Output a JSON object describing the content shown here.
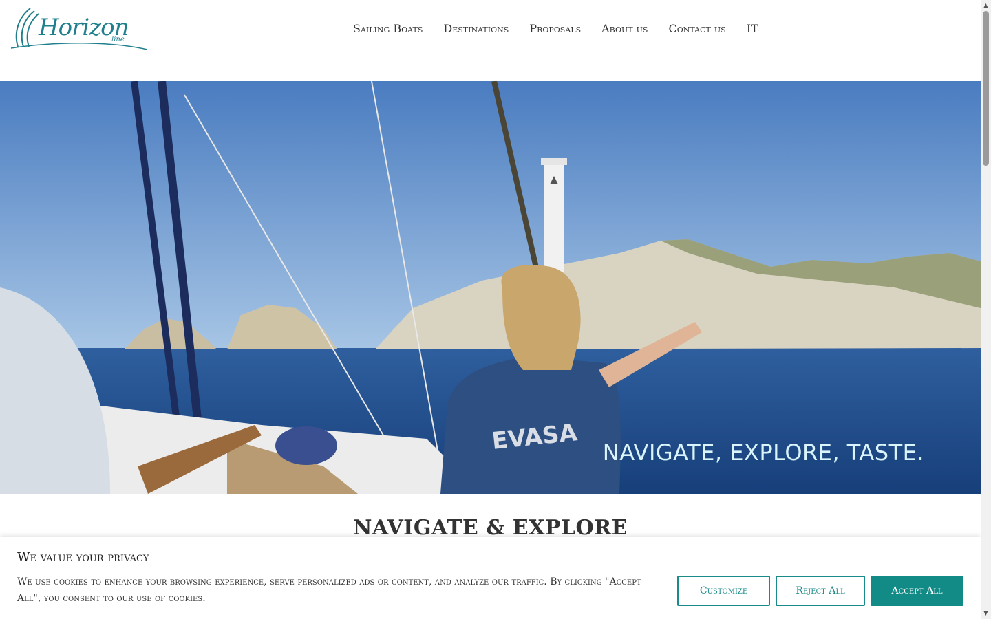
{
  "logo": {
    "text": "Horizon",
    "subtext": "line"
  },
  "nav": {
    "items": [
      {
        "label": "Sailing Boats"
      },
      {
        "label": "Destinations"
      },
      {
        "label": "Proposals"
      },
      {
        "label": "About us"
      },
      {
        "label": "Contact us"
      },
      {
        "label": "IT"
      }
    ]
  },
  "hero": {
    "caption": "NAVIGATE, EXPLORE, TASTE.",
    "shirt_text": "EVASA"
  },
  "section": {
    "title": "NAVIGATE & EXPLORE"
  },
  "cookie": {
    "title": "We value your privacy",
    "text": "We use cookies to enhance your browsing experience, serve personalized ads or content, and analyze our traffic. By clicking \"Accept All\", you consent to our use of cookies.",
    "customize_label": "Customize",
    "reject_label": "Reject All",
    "accept_label": "Accept All"
  },
  "colors": {
    "brand": "#1f7f8c",
    "accent": "#128a86"
  }
}
